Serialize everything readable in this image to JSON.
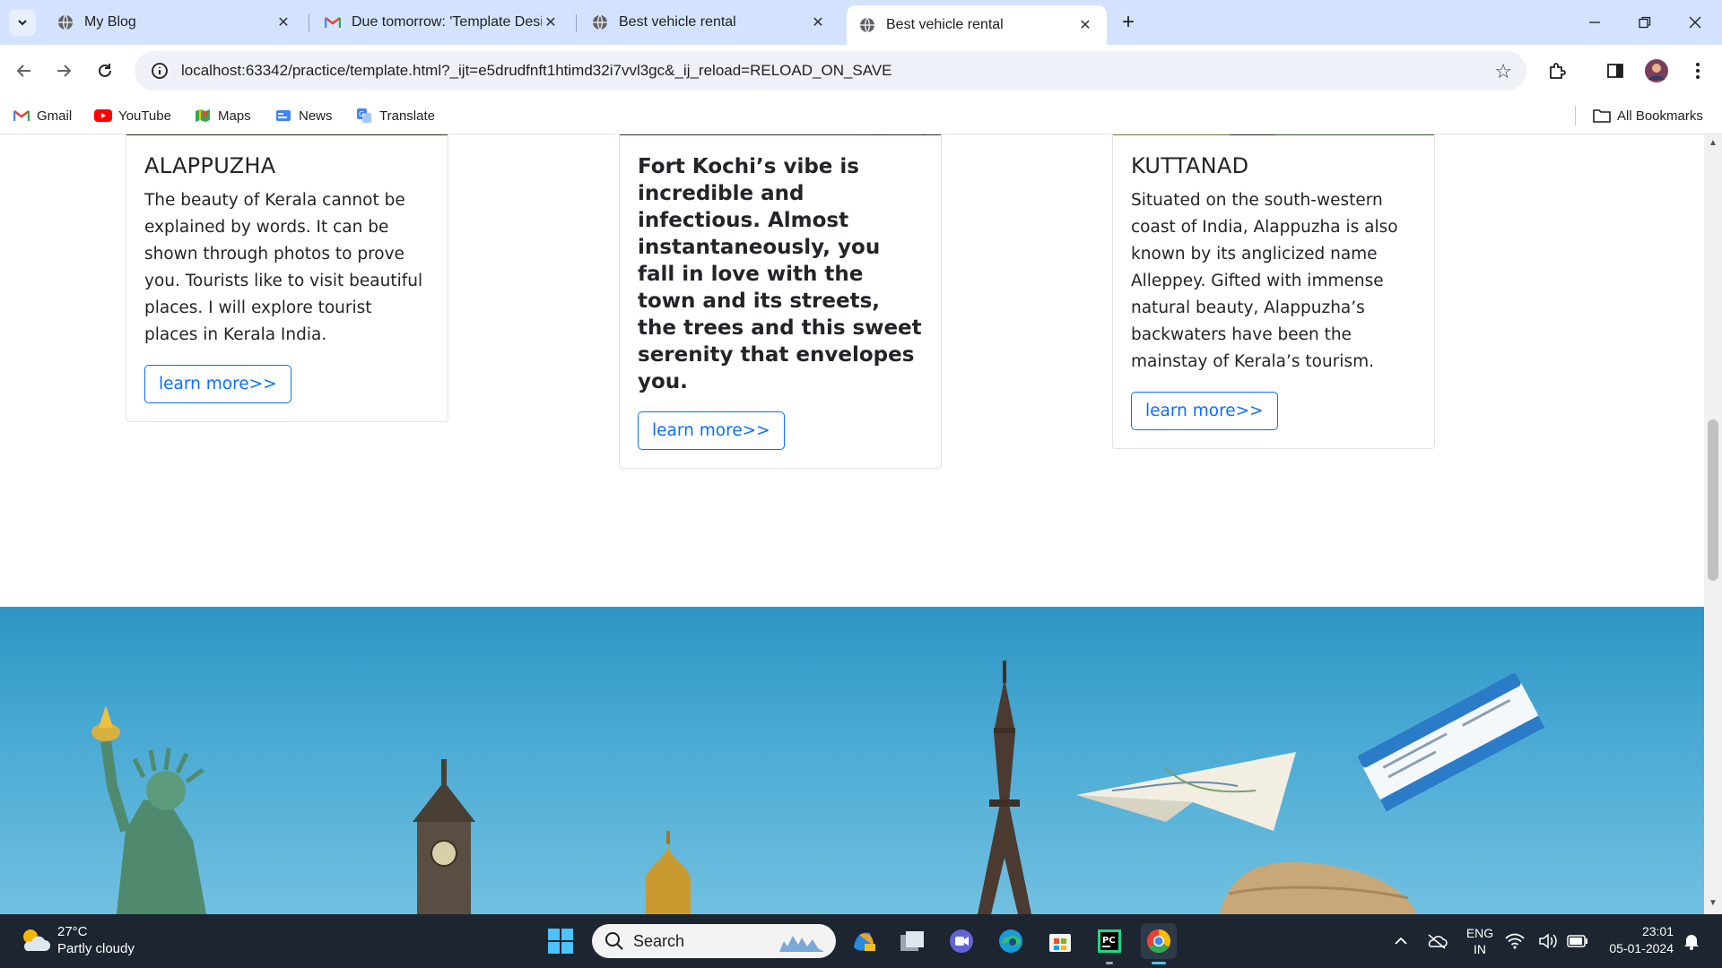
{
  "browser": {
    "tabs": [
      {
        "title": "My Blog",
        "icon": "globe-icon",
        "active": false
      },
      {
        "title": "Due tomorrow: 'Template Desig",
        "icon": "gmail-icon",
        "active": false
      },
      {
        "title": "Best vehicle rental",
        "icon": "globe-icon",
        "active": false
      },
      {
        "title": "Best vehicle rental",
        "icon": "globe-icon",
        "active": true
      }
    ],
    "url": "localhost:63342/practice/template.html?_ijt=e5drudfnft1htimd32i7vvl3gc&_ij_reload=RELOAD_ON_SAVE",
    "bookmarks": [
      {
        "label": "Gmail",
        "icon": "gmail-icon"
      },
      {
        "label": "YouTube",
        "icon": "youtube-icon"
      },
      {
        "label": "Maps",
        "icon": "maps-icon"
      },
      {
        "label": "News",
        "icon": "news-icon"
      },
      {
        "label": "Translate",
        "icon": "translate-icon"
      }
    ],
    "all_bookmarks": "All Bookmarks"
  },
  "page": {
    "cards": [
      {
        "title": "ALAPPUZHA",
        "text": "The beauty of Kerala cannot be explained by words. It can be shown through photos to prove you. Tourists like to visit beautiful places. I will explore tourist places in Kerala India.",
        "bold": false,
        "button": "learn more>>"
      },
      {
        "title": "",
        "text": "Fort Kochi’s vibe is incredible and infectious. Almost instantaneously, you fall in love with the town and its streets, the trees and this sweet serenity that envelopes you.",
        "bold": true,
        "button": "learn more>>"
      },
      {
        "title": "KUTTANAD",
        "text": "Situated on the south-western coast of India, Alappuzha is also known by its anglicized name Alleppey. Gifted with immense natural beauty, Alappuzha’s backwaters have been the mainstay of Kerala’s tourism.",
        "bold": false,
        "button": "learn more>>"
      }
    ]
  },
  "taskbar": {
    "weather_temp": "27°C",
    "weather_desc": "Partly cloudy",
    "search_placeholder": "Search",
    "lang_top": "ENG",
    "lang_bottom": "IN",
    "time": "23:01",
    "date": "05-01-2024"
  },
  "colors": {
    "tabstrip": "#d3e3fd",
    "link_blue": "#0d6efd",
    "taskbar": "#1c2530"
  }
}
